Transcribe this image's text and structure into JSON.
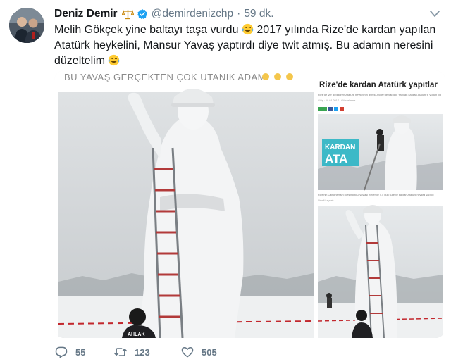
{
  "tweet": {
    "display_name": "Deniz Demir",
    "handle": "@demirdenizchp",
    "separator": "·",
    "time": "59 dk.",
    "text_part1": "Melih Gökçek yine baltayı taşa vurdu ",
    "text_part2": " 2017 yılında Rize'de kardan yapılan Atatürk heykelini, Mansur Yavaş yaptırdı diye twit atmış. Bu adamın neresini düzeltelim ",
    "emoji": "laughing-tears-emoji"
  },
  "media": {
    "left_caption": "BU YAVAŞ GERÇEKTEN ÇOK UTANIK ADAM",
    "left_jacket_text": "AHLAK",
    "article_headline": "Rize'de kardan Atatürk yapıtlar",
    "article_sub": "Rize'de yer değiştiren Atatürk heykelinin aynısı Ayder'de yapıldı. Yapılan kardan Atatürk'e yoğun ilgi",
    "article_meta": "Giriş : 19.01.2017  |  Güncelleme",
    "article_banner_line1": "KARDAN",
    "article_banner_line2": "ATA",
    "article_photo_caption": "Rize'nin Çamlıhemşin ilçesindeki 2 yaylası Ayder'de 4.5 gün süreyle kardan Atatürk heykeli yapıldı",
    "article_byline": "Şimdi kaynak"
  },
  "actions": {
    "replies": "55",
    "retweets": "123",
    "likes": "505"
  },
  "colors": {
    "text": "#14171a",
    "secondary": "#657786",
    "verified": "#1da1f2",
    "banner": "#2fb5c4"
  }
}
